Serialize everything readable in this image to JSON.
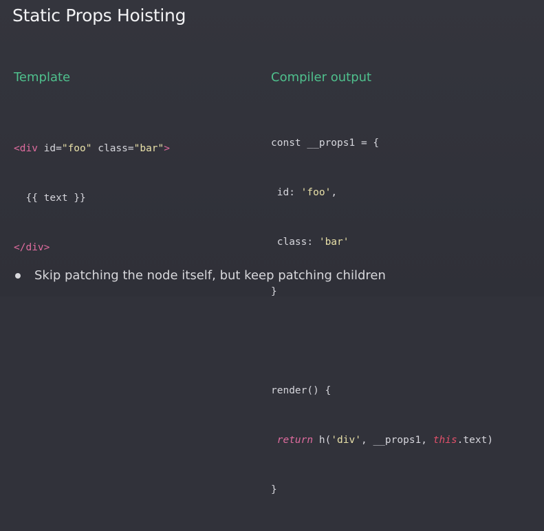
{
  "slide": {
    "title": "Static Props Hoisting",
    "template_label": "Template",
    "output_label": "Compiler output",
    "template_code": {
      "line1": {
        "open": "<div",
        "attr1": " id=",
        "val1": "\"foo\"",
        "attr2": " class=",
        "val2": "\"bar\"",
        "close": ">"
      },
      "line2": "  {{ text }}",
      "line3": "</div>"
    },
    "output_code": {
      "l1_kw": "const __props1 = {",
      "l2_key": " id: ",
      "l2_val": "'foo'",
      "l2_end": ",",
      "l3_key": " class: ",
      "l3_val": "'bar'",
      "l4": "}",
      "l5": "",
      "l6": "render() {",
      "l7_return": "return",
      "l7_mid": " h(",
      "l7_str": "'div'",
      "l7_args": ", __props1, ",
      "l7_this": "this",
      "l7_end": ".text)",
      "l8": "}"
    },
    "bullet": "Skip patching the node itself, but keep patching children"
  },
  "colors": {
    "background": "#31323a",
    "accent_green": "#4fc08d",
    "string_yellow": "#e8e0a8",
    "keyword_pink": "#e06c9f"
  }
}
